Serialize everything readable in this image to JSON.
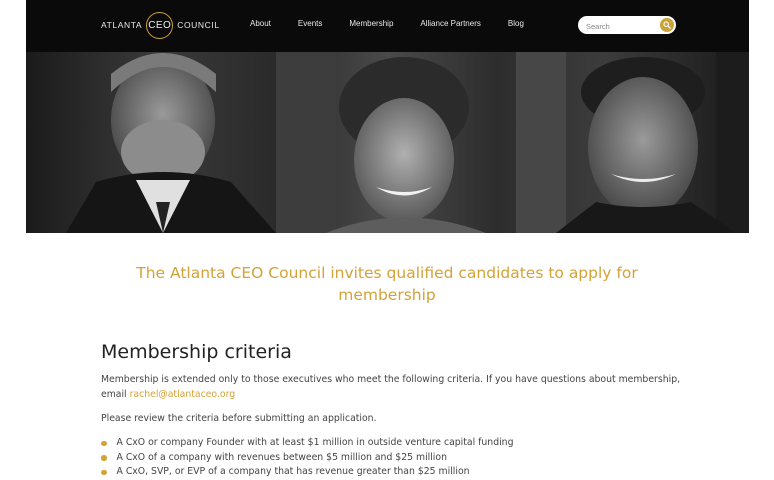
{
  "header": {
    "logo": {
      "left": "ATLANTA",
      "center": "CEO",
      "right": "COUNCIL"
    },
    "nav": [
      "About",
      "Events",
      "Membership",
      "Alliance Partners",
      "Blog"
    ],
    "search": {
      "placeholder": "Search",
      "value": ""
    }
  },
  "hero": {
    "image": "hero-photo"
  },
  "headline": "The Atlanta CEO Council invites qualified candidates to apply for membership",
  "content": {
    "title": "Membership criteria",
    "intro": "Membership is extended only to those executives who meet the following criteria. If you have questions about membership, email ",
    "email": "rachel@atlantaceo.org",
    "review": "Please review the criteria before submitting an application.",
    "criteria": [
      "A CxO or company Founder with at least $1 million in outside venture capital funding",
      "A CxO of a company with revenues between $5 million and $25 million",
      "A CxO, SVP, or EVP of a company that has revenue greater than $25 million"
    ]
  },
  "colors": {
    "accent": "#d4a237",
    "header_bg": "#0a0a0a"
  }
}
